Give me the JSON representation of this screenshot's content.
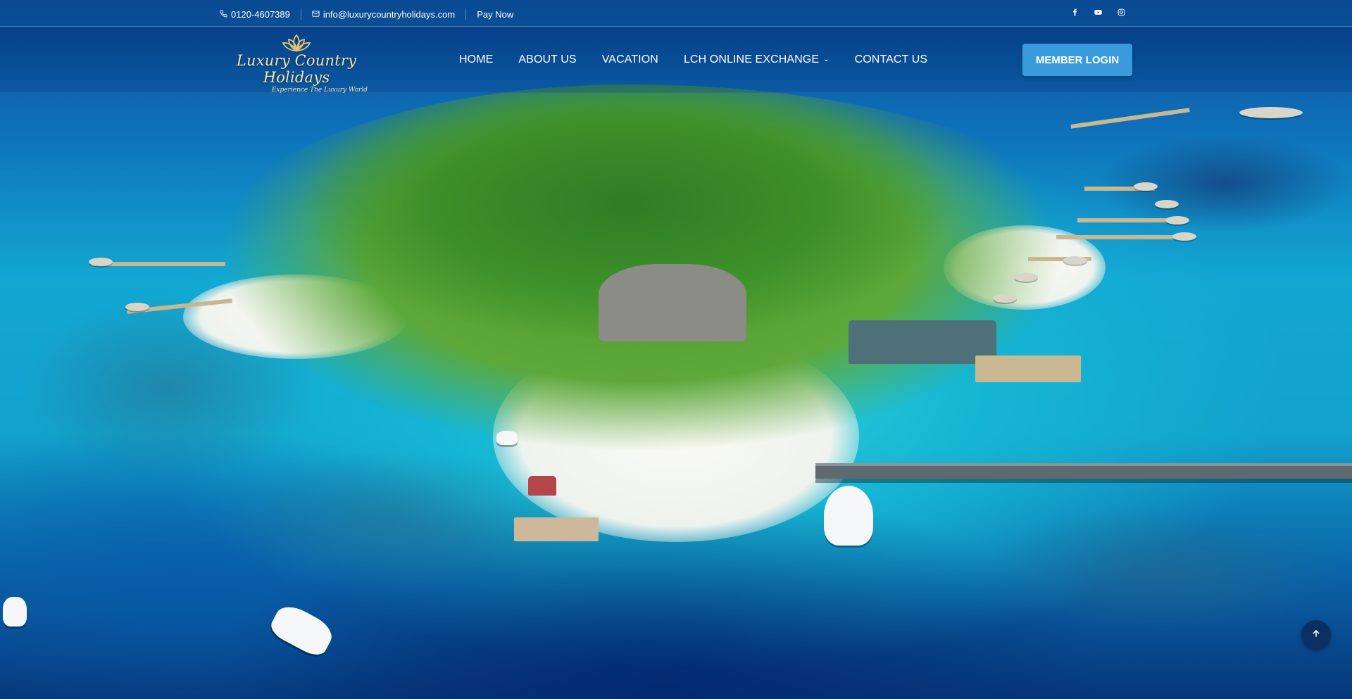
{
  "topbar": {
    "phone": "0120-4607389",
    "email": "info@luxurycountryholidays.com",
    "pay_now": "Pay Now",
    "social": [
      "facebook-icon",
      "youtube-icon",
      "instagram-icon"
    ]
  },
  "header": {
    "logo": {
      "brand": "Luxury Country Holidays",
      "tagline": "Experience The Luxury World"
    },
    "nav": [
      {
        "label": "HOME"
      },
      {
        "label": "ABOUT US"
      },
      {
        "label": "VACATION"
      },
      {
        "label": "LCH ONLINE EXCHANGE",
        "has_dropdown": true
      },
      {
        "label": "CONTACT US"
      }
    ],
    "login_label": "MEMBER LOGIN"
  },
  "colors": {
    "accent": "#3a9bdc",
    "back_to_top": "#0b2f63",
    "logo_gold": "#f3d38a"
  },
  "scroll_top": {
    "icon": "arrow-up-icon"
  }
}
